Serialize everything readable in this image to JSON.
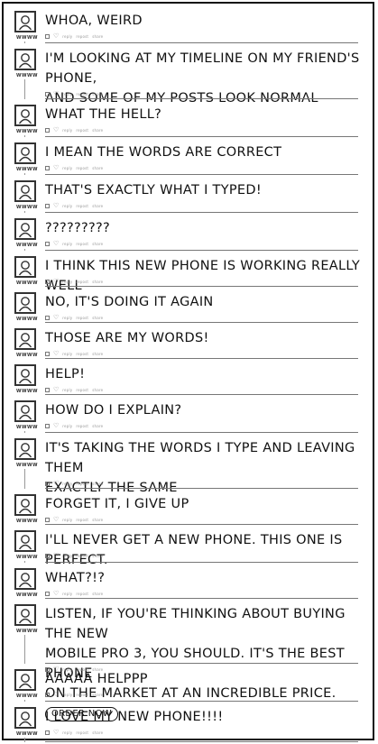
{
  "username": "WWWW",
  "meta_labels": [
    "reply",
    "repost",
    "share"
  ],
  "posts": [
    {
      "lines": [
        "WHOA, WEIRD"
      ]
    },
    {
      "lines": [
        "I'M LOOKING AT MY TIMELINE ON MY FRIEND'S PHONE,",
        "AND SOME OF MY POSTS LOOK NORMAL"
      ]
    },
    {
      "lines": [
        "WHAT THE HELL?"
      ]
    },
    {
      "lines": [
        "I MEAN THE WORDS ARE CORRECT"
      ]
    },
    {
      "lines": [
        "THAT'S EXACTLY WHAT I TYPED!"
      ]
    },
    {
      "lines": [
        "?????????"
      ]
    },
    {
      "lines": [
        "I THINK THIS NEW PHONE IS WORKING REALLY WELL"
      ]
    },
    {
      "lines": [
        "NO, IT'S DOING IT AGAIN"
      ]
    },
    {
      "lines": [
        "THOSE ARE MY WORDS!"
      ]
    },
    {
      "lines": [
        "HELP!"
      ]
    },
    {
      "lines": [
        "HOW DO I EXPLAIN?"
      ]
    },
    {
      "lines": [
        "IT'S TAKING THE WORDS I TYPE AND LEAVING THEM",
        "EXACTLY THE SAME"
      ]
    },
    {
      "lines": [
        "FORGET IT, I GIVE UP"
      ]
    },
    {
      "lines": [
        "I'LL NEVER GET A NEW PHONE. THIS ONE IS PERFECT."
      ]
    },
    {
      "lines": [
        "WHAT?!?"
      ]
    },
    {
      "lines": [
        "LISTEN, IF YOU'RE THINKING ABOUT BUYING THE NEW",
        "MOBILE PRO 3, YOU SHOULD. IT'S THE BEST PHONE",
        "ON THE MARKET AT AN INCREDIBLE PRICE."
      ],
      "button": "ORDER NOW"
    },
    {
      "lines": [
        "AAAAA HELPPP"
      ]
    },
    {
      "lines": [
        "I LOVE MY NEW PHONE!!!!"
      ]
    }
  ]
}
